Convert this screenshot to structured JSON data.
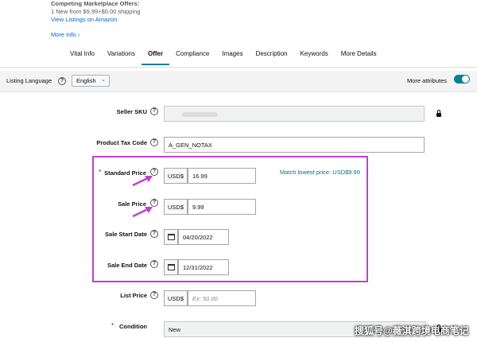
{
  "offers": {
    "title": "Competing Marketplace Offers:",
    "summary": "1 New  from $9.99+$0.00 shipping",
    "view_link": "View Listings on Amazon",
    "more_info": "More Info ›"
  },
  "tabs": [
    {
      "label": "Vital Info"
    },
    {
      "label": "Variations"
    },
    {
      "label": "Offer",
      "active": true
    },
    {
      "label": "Compliance"
    },
    {
      "label": "Images"
    },
    {
      "label": "Description"
    },
    {
      "label": "Keywords"
    },
    {
      "label": "More Details"
    }
  ],
  "listing_language": {
    "label": "Listing Language",
    "value": "English",
    "more_attributes_label": "More attributes",
    "more_attributes_on": true
  },
  "form": {
    "seller_sku": {
      "label": "Seller SKU",
      "value": ""
    },
    "tax_code": {
      "label": "Product Tax Code",
      "value": "A_GEN_NOTAX"
    },
    "standard_price": {
      "label": "Standard Price",
      "required": "*",
      "currency": "USD$",
      "value": "16.99",
      "match": "Match lowest price: USD$9.99"
    },
    "sale_price": {
      "label": "Sale Price",
      "currency": "USD$",
      "value": "9.99"
    },
    "sale_start": {
      "label": "Sale Start Date",
      "value": "04/20/2022"
    },
    "sale_end": {
      "label": "Sale End Date",
      "value": "12/31/2022"
    },
    "list_price": {
      "label": "List Price",
      "currency": "USD$",
      "placeholder": "Ex: 50.00"
    },
    "condition": {
      "label": "Condition",
      "required": "*",
      "value": "New"
    }
  },
  "help_glyph": "?",
  "watermark": "搜狐号@薇淇跨境电商笔记",
  "colors": {
    "accent": "#008296",
    "highlight": "#c23fd1",
    "link": "#0066c0"
  }
}
